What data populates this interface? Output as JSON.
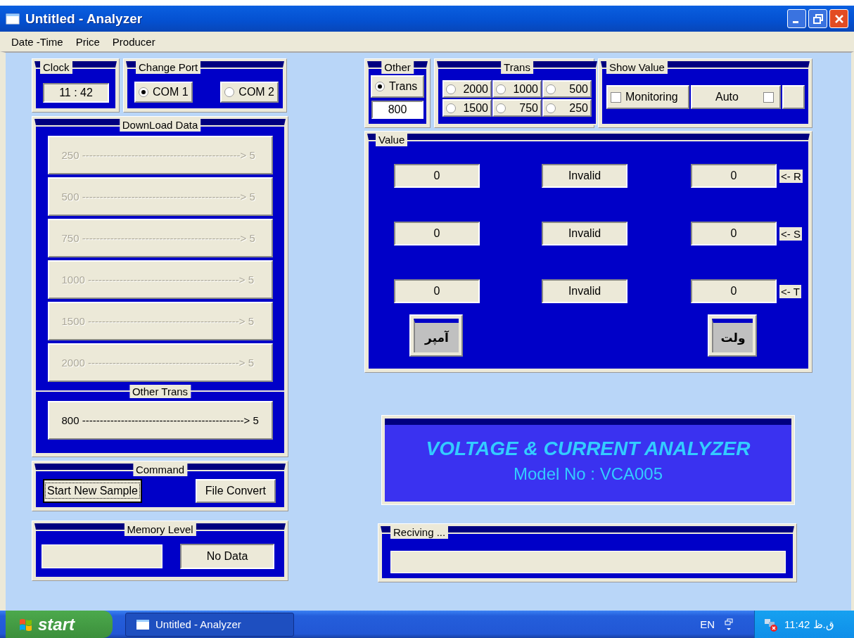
{
  "window": {
    "title": "Untitled - Analyzer"
  },
  "menu": [
    "Date -Time",
    "Price",
    "Producer"
  ],
  "clock": {
    "caption": "Clock",
    "value": "11 : 42"
  },
  "change_port": {
    "caption": "Change Port",
    "options": [
      {
        "label": "COM 1",
        "selected": true
      },
      {
        "label": "COM 2",
        "selected": false
      }
    ]
  },
  "download": {
    "caption": "DownLoad Data",
    "buttons": [
      {
        "label": "250 ---------------------------------------------> 5",
        "disabled": true
      },
      {
        "label": "500 ---------------------------------------------> 5",
        "disabled": true
      },
      {
        "label": "750 ---------------------------------------------> 5",
        "disabled": true
      },
      {
        "label": "1000 -------------------------------------------> 5",
        "disabled": true
      },
      {
        "label": "1500 -------------------------------------------> 5",
        "disabled": true
      },
      {
        "label": "2000 -------------------------------------------> 5",
        "disabled": true
      }
    ],
    "other_caption": "Other Trans",
    "other_button": {
      "label": "800 ----------------------------------------------> 5",
      "disabled": false
    }
  },
  "command": {
    "caption": "Command",
    "buttons": [
      {
        "label": "Start New Sample",
        "focused": true
      },
      {
        "label": "File Convert",
        "focused": false
      }
    ]
  },
  "memory": {
    "caption": "Memory Level",
    "status": "No Data"
  },
  "other": {
    "caption": "Other",
    "radio": {
      "label": "Trans",
      "selected": true
    },
    "value": "800"
  },
  "trans": {
    "caption": "Trans",
    "options": [
      {
        "label": "2000",
        "selected": false
      },
      {
        "label": "1000",
        "selected": false
      },
      {
        "label": "500",
        "selected": false
      },
      {
        "label": "1500",
        "selected": false
      },
      {
        "label": "750",
        "selected": false
      },
      {
        "label": "250",
        "selected": false
      }
    ]
  },
  "show_value": {
    "caption": "Show Value",
    "monitoring": {
      "label": "Monitoring",
      "checked": false
    },
    "auto": {
      "label": "Auto",
      "checked": false
    }
  },
  "value": {
    "caption": "Value",
    "rows": [
      {
        "current": "0",
        "status": "Invalid",
        "voltage": "0",
        "phase": "<- R"
      },
      {
        "current": "0",
        "status": "Invalid",
        "voltage": "0",
        "phase": "<- S"
      },
      {
        "current": "0",
        "status": "Invalid",
        "voltage": "0",
        "phase": "<- T"
      }
    ],
    "current_button": "آمپر",
    "voltage_button": "ولت"
  },
  "banner": {
    "title": "VOLTAGE & CURRENT ANALYZER",
    "model": "Model No : VCA005"
  },
  "receiving": {
    "caption": "Reciving ..."
  },
  "taskbar": {
    "start": "start",
    "task": "Untitled - Analyzer",
    "language": "EN",
    "clock": "11:42 ق.ظ"
  }
}
